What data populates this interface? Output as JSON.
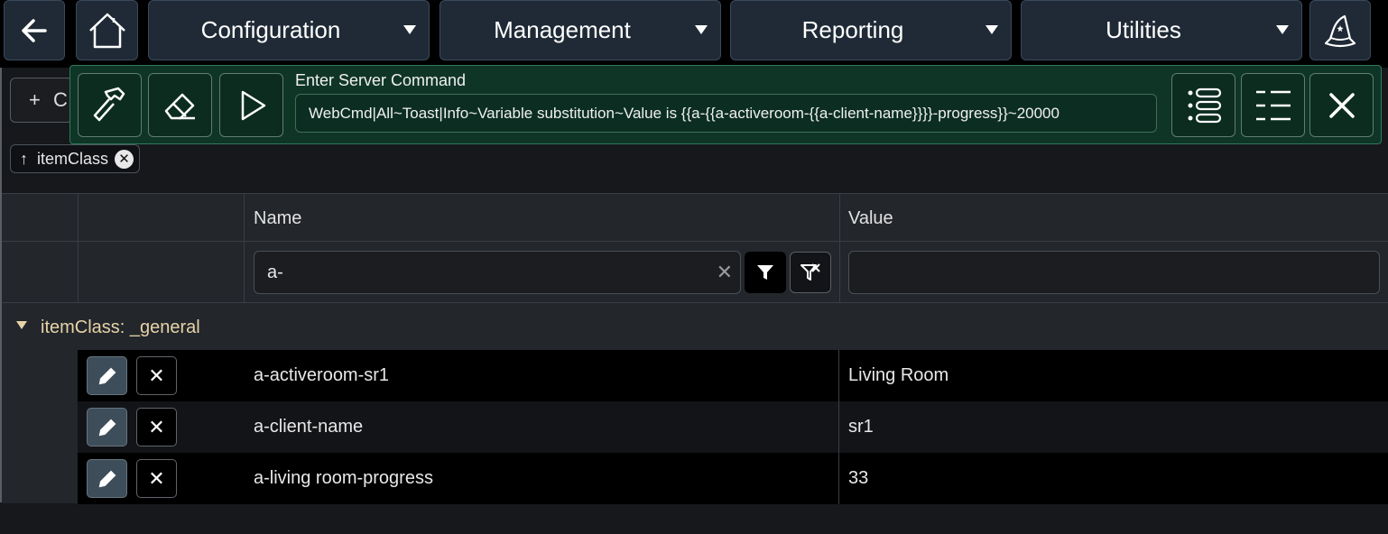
{
  "navbar": {
    "back_icon": "arrow-left-icon",
    "home_icon": "home-icon",
    "menus": [
      "Configuration",
      "Management",
      "Reporting",
      "Utilities"
    ],
    "wizard_icon": "wizard-hat-icon"
  },
  "toolbar": {
    "add_label": "C"
  },
  "sort_chip": {
    "label": "itemClass"
  },
  "server_command": {
    "title": "Enter Server Command",
    "value": "WebCmd|All~Toast|Info~Variable substitution~Value is {{a-{{a-activeroom-{{a-client-name}}}}-progress}}~20000"
  },
  "table": {
    "columns": {
      "name": "Name",
      "value": "Value"
    },
    "filter": {
      "name_value": "a-"
    },
    "group": {
      "label": "itemClass: _general"
    },
    "rows": [
      {
        "name": "a-activeroom-sr1",
        "value": "Living Room"
      },
      {
        "name": "a-client-name",
        "value": "sr1"
      },
      {
        "name": "a-living room-progress",
        "value": "33"
      }
    ]
  },
  "colors": {
    "accent_green": "#0f3527",
    "group_label": "#e6d3a8",
    "nav_button": "#1f2a36"
  }
}
